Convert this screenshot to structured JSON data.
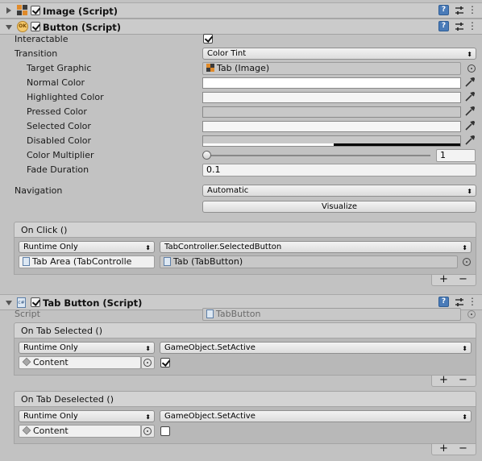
{
  "image_component": {
    "title": "Image (Script)",
    "enabled": true
  },
  "button_component": {
    "title": "Button (Script)",
    "enabled": true,
    "interactable_label": "Interactable",
    "interactable": true,
    "transition_label": "Transition",
    "transition_value": "Color Tint",
    "target_graphic_label": "Target Graphic",
    "target_graphic_value": "Tab (Image)",
    "normal_color_label": "Normal Color",
    "highlighted_color_label": "Highlighted Color",
    "pressed_color_label": "Pressed Color",
    "selected_color_label": "Selected Color",
    "disabled_color_label": "Disabled Color",
    "colors": {
      "normal": "#ffffff",
      "highlighted": "#f5f5f5",
      "pressed": "#c8c8c8",
      "selected": "#f5f5f5",
      "disabled": "#c8c8c8"
    },
    "color_multiplier_label": "Color Multiplier",
    "color_multiplier_value": "1",
    "color_multiplier_fraction": 0,
    "fade_duration_label": "Fade Duration",
    "fade_duration_value": "0.1",
    "navigation_label": "Navigation",
    "navigation_value": "Automatic",
    "visualize_label": "Visualize",
    "on_click": {
      "header": "On Click ()",
      "runtime": "Runtime Only",
      "function": "TabController.SelectedButton",
      "object": "Tab Area (TabControlle",
      "argument": "Tab (TabButton)"
    }
  },
  "tab_button_component": {
    "title": "Tab Button (Script)",
    "enabled": true,
    "script_label": "Script",
    "script_value": "TabButton",
    "on_tab_selected": {
      "header": "On Tab Selected ()",
      "runtime": "Runtime Only",
      "function": "GameObject.SetActive",
      "object": "Content",
      "argument_checked": true
    },
    "on_tab_deselected": {
      "header": "On Tab Deselected ()",
      "runtime": "Runtime Only",
      "function": "GameObject.SetActive",
      "object": "Content",
      "argument_checked": false
    }
  },
  "list_controls": {
    "plus": "+",
    "minus": "−"
  },
  "icons": {
    "help": "help-icon",
    "presets": "presets-icon",
    "settings": "gear-icon",
    "picker": "eyedropper-icon",
    "object_picker": "object-picker-icon"
  }
}
